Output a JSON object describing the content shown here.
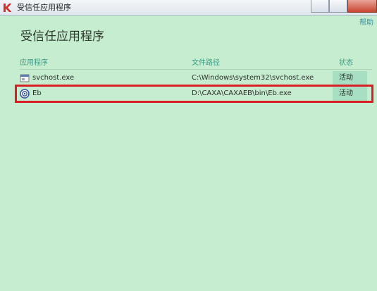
{
  "window": {
    "title": "受信任应用程序",
    "icon": "kaspersky-k-icon"
  },
  "header": {
    "title": "受信任应用程序",
    "help_label": "帮助"
  },
  "table": {
    "columns": [
      "应用程序",
      "文件路径",
      "状态"
    ],
    "rows": [
      {
        "name": "svchost.exe",
        "path": "C:\\Windows\\system32\\svchost.exe",
        "status": "活动",
        "icon": "exe-file-icon"
      },
      {
        "name": "Eb",
        "path": "D:\\CAXA\\CAXAEB\\bin\\Eb.exe",
        "status": "活动",
        "icon": "eb-app-icon"
      }
    ]
  },
  "colors": {
    "background": "#c6edcf",
    "accent": "#3a9a86",
    "highlight": "#d91e24",
    "status_bg": "#a7dfc2"
  }
}
